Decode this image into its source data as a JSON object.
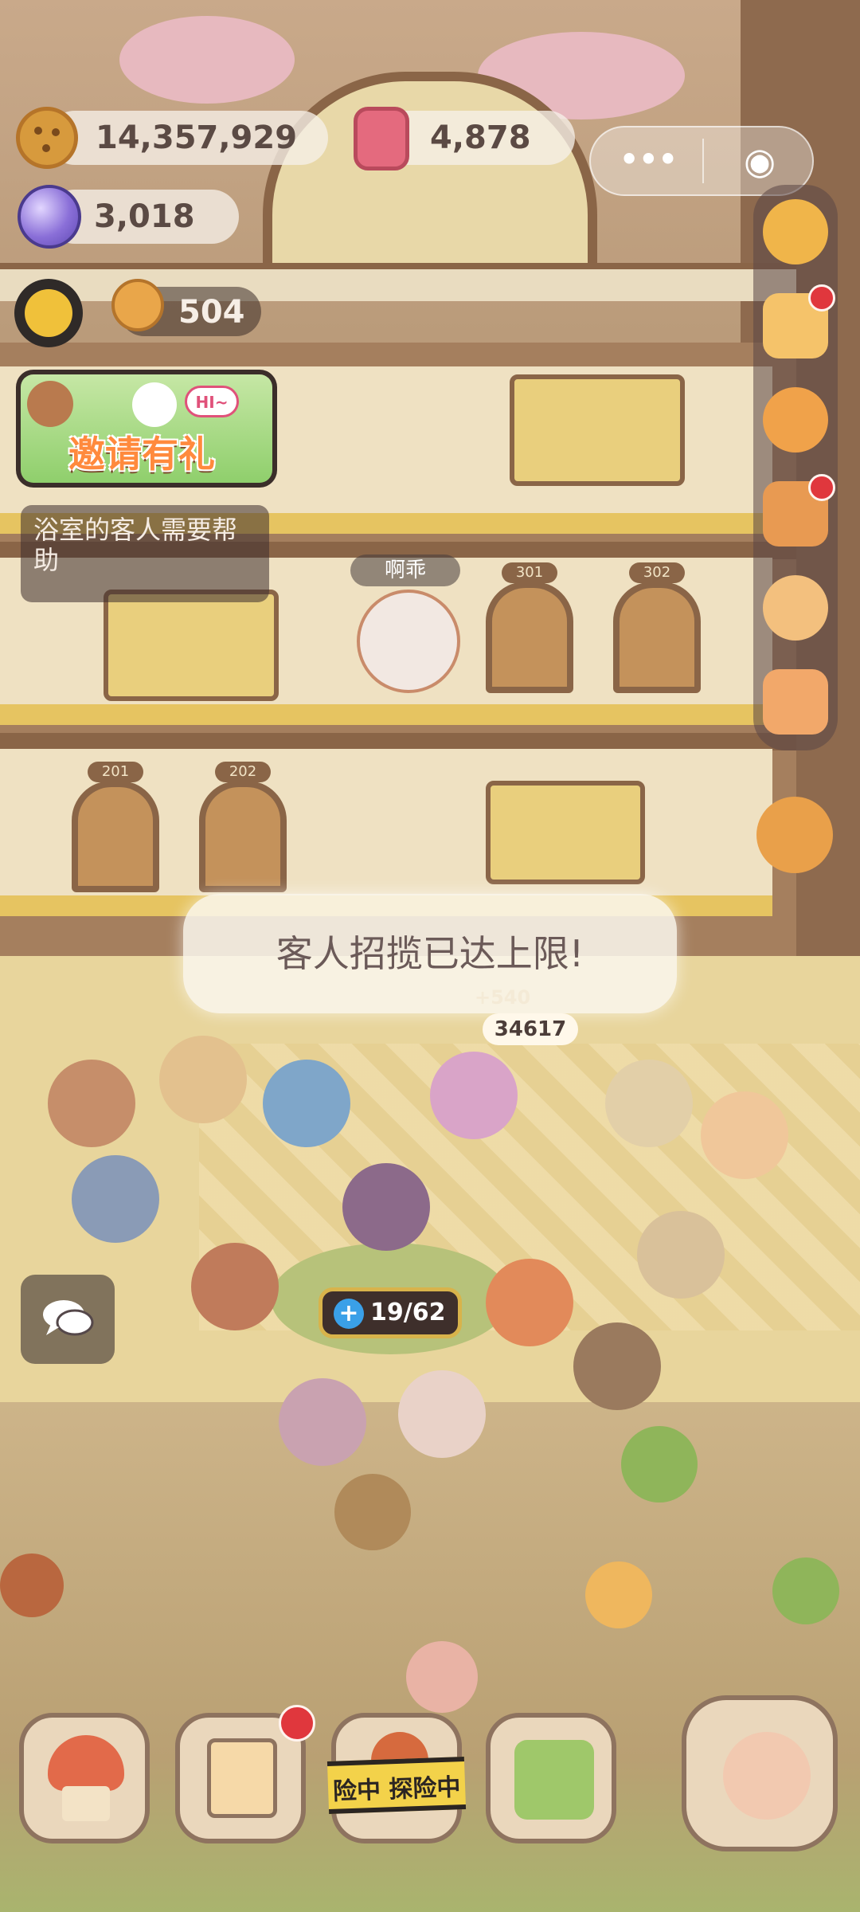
{
  "hud": {
    "cookies": "14,357,929",
    "gems": "4,878",
    "orbs": "3,018",
    "helpers": "504"
  },
  "mini_program": {
    "more_glyph": "•••",
    "close_glyph": "◉"
  },
  "invite": {
    "label": "邀请有礼",
    "bubble": "HI~"
  },
  "tip": "浴室的客人需要帮助",
  "character_name": "啊乖",
  "rooms": [
    "301",
    "302",
    "201",
    "202"
  ],
  "toast": "客人招揽已达上限!",
  "score": {
    "float": "+540",
    "total": "34617"
  },
  "guests_counter": {
    "plus": "+",
    "value": "19/62"
  },
  "bottom_bar": {
    "explore_label": "险中 探险中"
  },
  "colors": {
    "badge_red": "#e0373d",
    "toast_bg": "#faf7ee",
    "invite_text": "#ff8a3d"
  },
  "icons": [
    "cookie-icon",
    "gem-icon",
    "orb-icon",
    "sun-icon",
    "settings-icon",
    "mail-icon",
    "star-icon",
    "bag-icon",
    "friends-icon",
    "camera-icon",
    "paint-icon",
    "chat-icon",
    "house-icon",
    "diary-icon",
    "shop-icon",
    "fish-icon"
  ]
}
